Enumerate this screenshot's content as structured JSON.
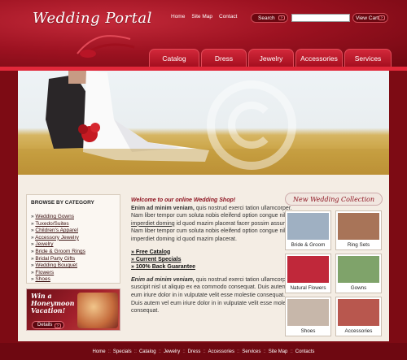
{
  "header": {
    "logo": "Wedding Portal",
    "top_links": [
      "Home",
      "Site Map",
      "Contact"
    ],
    "search_label": "Search",
    "search_placeholder": "",
    "cart_label": "View Cart"
  },
  "nav": [
    "Catalog",
    "Dress",
    "Jewelry",
    "Accessories",
    "Services"
  ],
  "categories": {
    "title": "BROWSE BY CATEGORY",
    "items": [
      "Wedding Gowns",
      "Tuxedo/Suites",
      "Children's Apparel",
      "Accessory Jewelry",
      "Jewelry",
      "Bride & Groom Rings",
      "Bridal Party Gifts",
      "Wedding Bouquet",
      "Flowers",
      "Shoes"
    ]
  },
  "promo": {
    "text": "Win a Honeymoon Vacation!",
    "button": "Details"
  },
  "content": {
    "intro_title": "Welcome to our online Wedding Shop!",
    "lead1": "Enim ad minim veniam,",
    "p1": " quis nostrud exerci tation ullamcorper. Nam liber tempor cum soluta nobis eleifend option congue nihil ",
    "p1_link": "imperdiet doming",
    "p1_end": " id quod mazim placerat facer possim assum. Nam liber tempor cum soluta nobis eleifend option congue nihil imperdiet doming id quod mazim placerat.",
    "links": [
      "Free Catalog",
      "Current Specials",
      "100% Back Guarantee"
    ],
    "lead2": "Enim ad minim veniam,",
    "p2": " quis nostrud exerci tation ullamcorper suscipit nisl ut aliquip ex ea commodo consequat. Duis autem vel eum iriure dolor in in vulputate velit esse molestie consequat. Duis autem vel eum iriure dolor in in vulputate velit esse molestie consequat."
  },
  "collection": {
    "title": "New Wedding Collection",
    "items": [
      "Bride & Groom",
      "Ring Sets",
      "Natural Flowers",
      "Gowns",
      "Shoes",
      "Accessories"
    ],
    "colors": [
      "#9fb0c2",
      "#a87458",
      "#c0283a",
      "#7fa36a",
      "#c7b7aa",
      "#b8574e"
    ]
  },
  "footer": [
    "Home",
    "Specials",
    "Catalog",
    "Jewelry",
    "Dress",
    "Accessories",
    "Services",
    "Site Map",
    "Contacts"
  ]
}
